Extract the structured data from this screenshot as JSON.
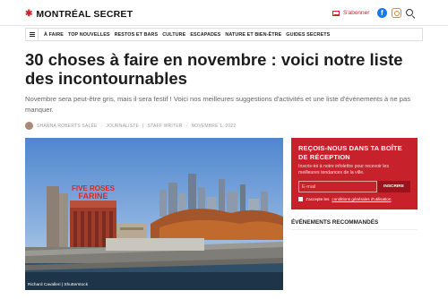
{
  "site": {
    "logo_text": "MONTRÉAL SECRET",
    "logo_symbol": "✱"
  },
  "header": {
    "subscribe_label": "S'abonner",
    "facebook_glyph": "f",
    "icons": [
      "mail-icon",
      "facebook-icon",
      "instagram-icon",
      "search-icon"
    ]
  },
  "nav": {
    "items": [
      "À FAIRE",
      "TOP NOUVELLES",
      "RESTOS ET BARS",
      "CULTURE",
      "ESCAPADES",
      "NATURE ET BIEN-ÊTRE",
      "GUIDES SECRETS"
    ]
  },
  "article": {
    "title": "30 choses à faire en novembre : voici notre liste des incontournables",
    "dek": "Novembre sera peut-être gris, mais il sera festif ! Voici nos meilleures suggestions d'activités et une liste d'événements à ne pas manquer.",
    "author": "SHANNA ROBERTS SALÉE",
    "role": "JOURNALISTE",
    "position": "STAFF WRITER",
    "date": "NOVEMBRE 1, 2022",
    "image_caption": "Richard Cavalleri | Shutterstock"
  },
  "newsletter": {
    "title": "REÇOIS-NOUS DANS TA BOÎTE DE RÉCEPTION",
    "body": "Inscris-toi à notre infolettre pour recevoir les meilleures tendances de la ville.",
    "email_placeholder": "E-mail",
    "button": "INSCRIRE",
    "terms_prefix": "J'accepte les ",
    "terms_link": "conditions générales d'utilisation"
  },
  "sidebar": {
    "events_heading": "ÉVÉNEMENTS RECOMMANDÉS"
  },
  "colors": {
    "brand_red": "#c7222c",
    "facebook_blue": "#1877f2",
    "instagram_orange": "#e8842a"
  }
}
